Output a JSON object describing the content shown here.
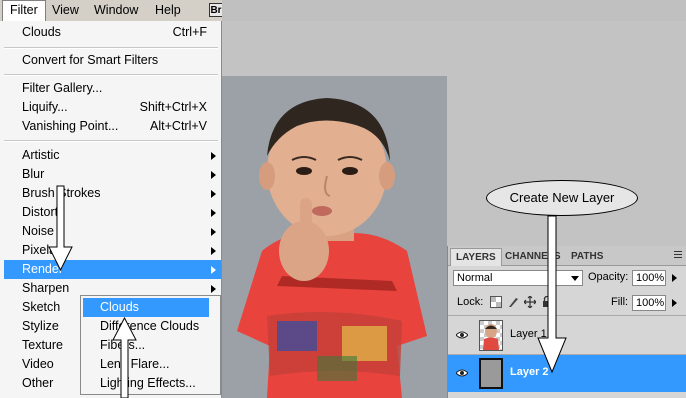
{
  "menubar": {
    "items": [
      {
        "label": "Filter",
        "active": true
      },
      {
        "label": "View"
      },
      {
        "label": "Window"
      },
      {
        "label": "Help"
      }
    ],
    "bridge_label": "Br"
  },
  "filter_menu": {
    "items": [
      {
        "label": "Clouds",
        "shortcut": "Ctrl+F"
      },
      {
        "label": "Convert for Smart Filters"
      },
      {
        "label": "Filter Gallery..."
      },
      {
        "label": "Liquify...",
        "shortcut": "Shift+Ctrl+X"
      },
      {
        "label": "Vanishing Point...",
        "shortcut": "Alt+Ctrl+V"
      },
      {
        "label": "Artistic",
        "submenu": true
      },
      {
        "label": "Blur",
        "submenu": true
      },
      {
        "label": "Brush Strokes",
        "submenu": true
      },
      {
        "label": "Distort",
        "submenu": true
      },
      {
        "label": "Noise",
        "submenu": true
      },
      {
        "label": "Pixelate",
        "submenu": true
      },
      {
        "label": "Render",
        "submenu": true,
        "highlighted": true
      },
      {
        "label": "Sharpen",
        "submenu": true
      },
      {
        "label": "Sketch",
        "submenu": true
      },
      {
        "label": "Stylize",
        "submenu": true
      },
      {
        "label": "Texture",
        "submenu": true
      },
      {
        "label": "Video",
        "submenu": true
      },
      {
        "label": "Other",
        "submenu": true
      }
    ]
  },
  "render_submenu": {
    "items": [
      {
        "label": "Clouds",
        "highlighted": true
      },
      {
        "label": "Difference Clouds"
      },
      {
        "label": "Fibers..."
      },
      {
        "label": "Lens Flare..."
      },
      {
        "label": "Lighting Effects..."
      }
    ]
  },
  "callout": {
    "text": "Create New Layer"
  },
  "layers_panel": {
    "tabs": [
      "LAYERS",
      "CHANNELS",
      "PATHS"
    ],
    "active_tab": "LAYERS",
    "blend_mode": "Normal",
    "opacity_label": "Opacity:",
    "opacity_value": "100%",
    "lock_label": "Lock:",
    "fill_label": "Fill:",
    "fill_value": "100%",
    "layers": [
      {
        "name": "Layer 1",
        "visible": true,
        "selected": false
      },
      {
        "name": "Layer 2",
        "visible": true,
        "selected": true
      }
    ]
  },
  "colors": {
    "highlight": "#3399ff",
    "canvas_background": "#9ba1a7",
    "app_background": "#c3c3c3"
  }
}
